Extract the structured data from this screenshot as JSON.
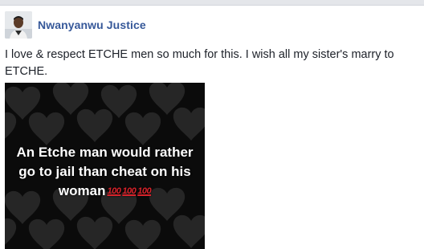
{
  "post": {
    "author_name": "Nwanyanwu Justice",
    "text": "I love & respect ETCHE men so much for this. I wish all my sister's marry to ETCHE.",
    "image": {
      "caption_lines": [
        "An Etche man would rather",
        "go to jail than cheat on his",
        "woman"
      ],
      "emoji": [
        "100",
        "100",
        "100"
      ]
    }
  },
  "colors": {
    "author": "#365899",
    "text": "#1d2129",
    "image_bg": "#0b0b0b",
    "heart": "#262626",
    "emoji_red": "#d9232b"
  },
  "icons": {
    "avatar": "profile-photo",
    "emoji": "hundred-points-icon"
  }
}
